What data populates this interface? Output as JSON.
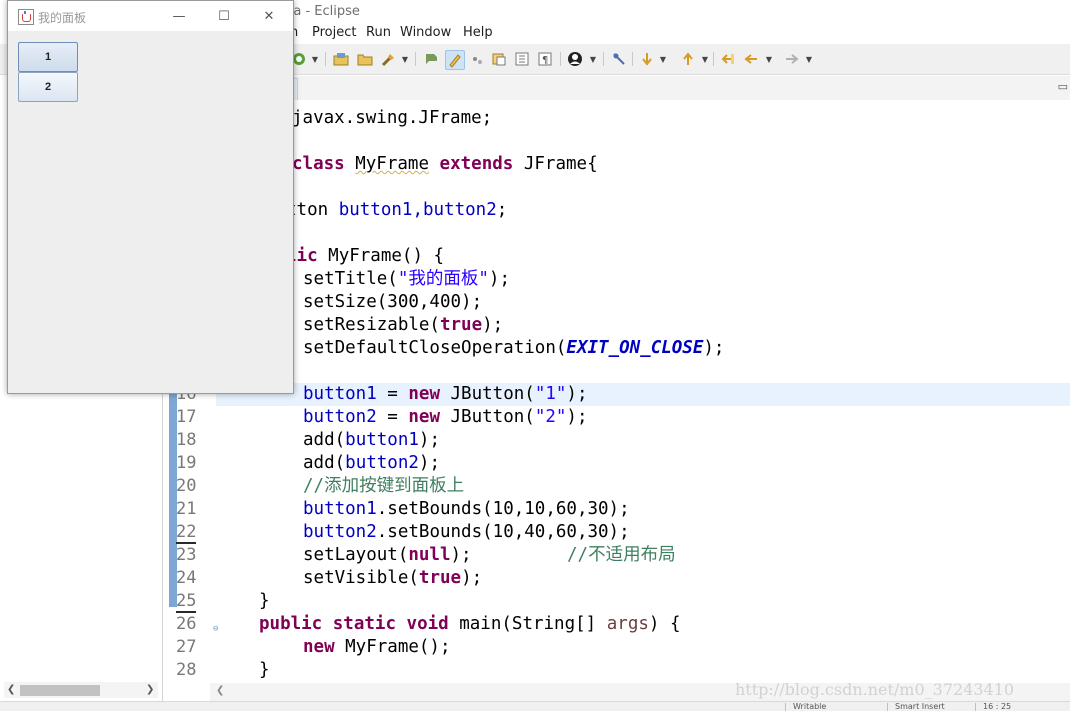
{
  "eclipse": {
    "title_fragment": "ra - Eclipse",
    "menu": [
      {
        "label": "h"
      },
      {
        "label": "Project"
      },
      {
        "label": "Run"
      },
      {
        "label": "Window"
      },
      {
        "label": "Help"
      }
    ]
  },
  "toolbar": {
    "icons": [
      "new-java-class-icon",
      "open-type-icon",
      "open-folder-icon",
      "search-torch-icon",
      "annotation-icon",
      "highlight-toggle-icon",
      "word-wrap-icon",
      "block-selection-icon",
      "show-whitespace-icon",
      "paragraph-icon",
      "user-icon",
      "pin-icon",
      "next-annotation-icon",
      "previous-annotation-icon",
      "last-edit-icon",
      "back-icon",
      "forward-icon"
    ]
  },
  "swing_window": {
    "title": "我的面板",
    "buttons": [
      {
        "label": "1"
      },
      {
        "label": "2"
      }
    ],
    "controls": {
      "minimize": "—",
      "maximize": "☐",
      "close": "✕"
    }
  },
  "editor": {
    "current_line": "16",
    "line_numbers": [
      "16",
      "17",
      "18",
      "19",
      "20",
      "21",
      "22",
      "23",
      "24",
      "25",
      "26",
      "27",
      "28"
    ],
    "visible_fragments": {
      "import_line": "javax.swing.JFrame;",
      "class_decl_kw": "class",
      "class_name": "MyFrame",
      "extends_kw": "extends",
      "super_class": "JFrame{",
      "field_type_frag": "tton",
      "field_names": "button1,button2",
      "ctor_kw_frag": "lic",
      "ctor_sig": "MyFrame() {"
    },
    "code": {
      "settitle_pre": "setTitle(",
      "settitle_str": "\"我的面板\"",
      "settitle_post": ");",
      "setsize": "setSize(300,400);",
      "setresizable_pre": "setResizable(",
      "setresizable_kw": "true",
      "setresizable_post": ");",
      "setdefault_pre": "setDefaultCloseOperation(",
      "setdefault_const": "EXIT_ON_CLOSE",
      "setdefault_post": ");",
      "l16_var": "button1",
      "l16_mid": " = ",
      "l16_new": "new",
      "l16_call": " JButton(",
      "l16_str": "\"1\"",
      "l16_end": ");",
      "l17_var": "button2",
      "l17_str": "\"2\"",
      "l18_add": "add(",
      "l18_arg": "button1",
      "l18_end": ");",
      "l19_arg": "button2",
      "l20_comment": "//添加按键到面板上",
      "l21_var": "button1",
      "l21_rest": ".setBounds(10,10,60,30);",
      "l22_var": "button2",
      "l22_rest": ".setBounds(10,40,60,30);",
      "l23_pre": "setLayout(",
      "l23_kw": "null",
      "l23_post": ");",
      "l23_comment": "//不适用布局",
      "l24_pre": "setVisible(",
      "l24_kw": "true",
      "l24_post": ");",
      "l25": "}",
      "l26_kw1": "public",
      "l26_kw2": "static",
      "l26_kw3": "void",
      "l26_sig": "main(String[]",
      "l26_param": "args",
      "l26_end": ") {",
      "l27_kw": "new",
      "l27_rest": " MyFrame();",
      "l28": "}"
    }
  },
  "watermark": "http://blog.csdn.net/m0_37243410",
  "statusbar": {
    "items": [
      "Writable",
      "Smart Insert",
      "16 : 25"
    ]
  }
}
